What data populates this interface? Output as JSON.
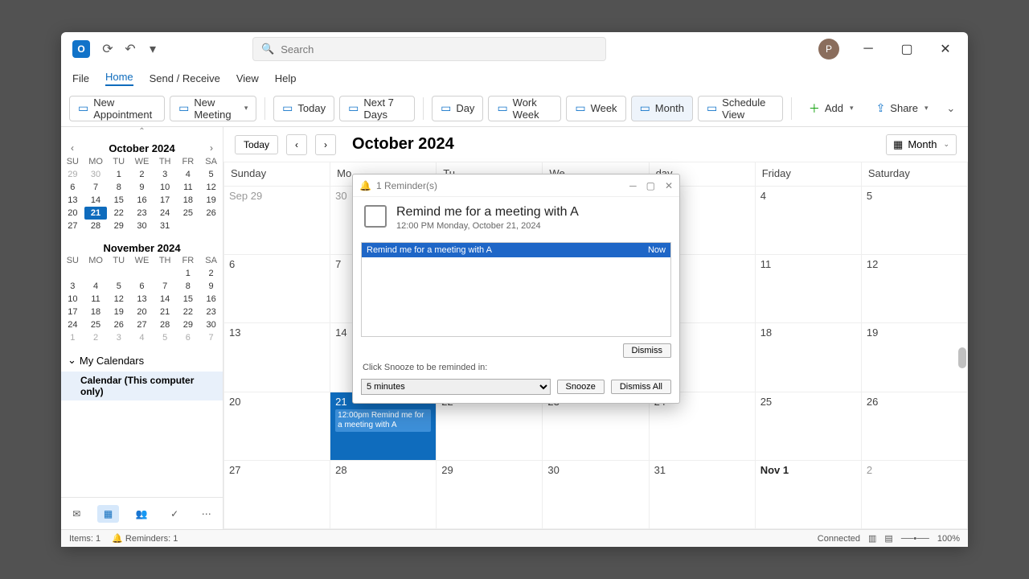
{
  "titlebar": {
    "search_placeholder": "Search",
    "avatar": "P"
  },
  "menu": {
    "file": "File",
    "home": "Home",
    "send": "Send / Receive",
    "view": "View",
    "help": "Help"
  },
  "ribbon": {
    "new_appt": "New Appointment",
    "new_meeting": "New Meeting",
    "today": "Today",
    "next7": "Next 7 Days",
    "day": "Day",
    "work_week": "Work Week",
    "week": "Week",
    "month": "Month",
    "schedule": "Schedule View",
    "add": "Add",
    "share": "Share"
  },
  "sidebar": {
    "month1": "October 2024",
    "month2": "November 2024",
    "dow": [
      "SU",
      "MO",
      "TU",
      "WE",
      "TH",
      "FR",
      "SA"
    ],
    "mycal": "My Calendars",
    "cal_item": "Calendar (This computer only)"
  },
  "main": {
    "today": "Today",
    "title": "October 2024",
    "view": "Month",
    "days": [
      "Sunday",
      "Mo",
      "Tu",
      "We",
      "day",
      "Friday",
      "Saturday"
    ],
    "event": "12:00pm Remind me for a meeting with A"
  },
  "reminder": {
    "title": "1 Reminder(s)",
    "heading": "Remind me for a meeting with A",
    "sub": "12:00 PM Monday, October 21, 2024",
    "row_label": "Remind me for a meeting with A",
    "row_time": "Now",
    "dismiss": "Dismiss",
    "hint": "Click Snooze to be reminded in:",
    "snooze_val": "5 minutes",
    "snooze": "Snooze",
    "dismiss_all": "Dismiss All"
  },
  "status": {
    "items": "Items: 1",
    "reminders": "Reminders: 1",
    "connected": "Connected",
    "zoom": "100%"
  }
}
